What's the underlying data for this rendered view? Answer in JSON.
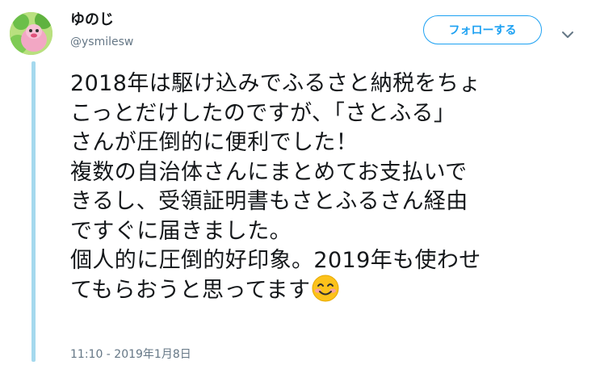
{
  "user": {
    "display_name": "ゆのじ",
    "handle": "@ysmilesw"
  },
  "follow_button": {
    "label": "フォローする"
  },
  "caret": {
    "icon": "chevron-down-icon"
  },
  "tweet": {
    "lines": [
      "2018年は駆け込みでふるさと納税をちょ",
      "こっとだけしたのですが、「さとふる」",
      "さんが圧倒的に便利でした！",
      "複数の自治体さんにまとめてお支払いで",
      "きるし、受領証明書もさとふるさん経由",
      "ですぐに届きました。",
      "個人的に圧倒的好印象。2019年も使わせ",
      "てもらおうと思ってます"
    ],
    "emoji": "smiling-face-with-smiling-eyes"
  },
  "timestamp": "11:10 - 2019年1月8日",
  "colors": {
    "accent": "#1da1f2",
    "text": "#14171a",
    "muted": "#657786",
    "thread_line": "#a5d9ee"
  }
}
